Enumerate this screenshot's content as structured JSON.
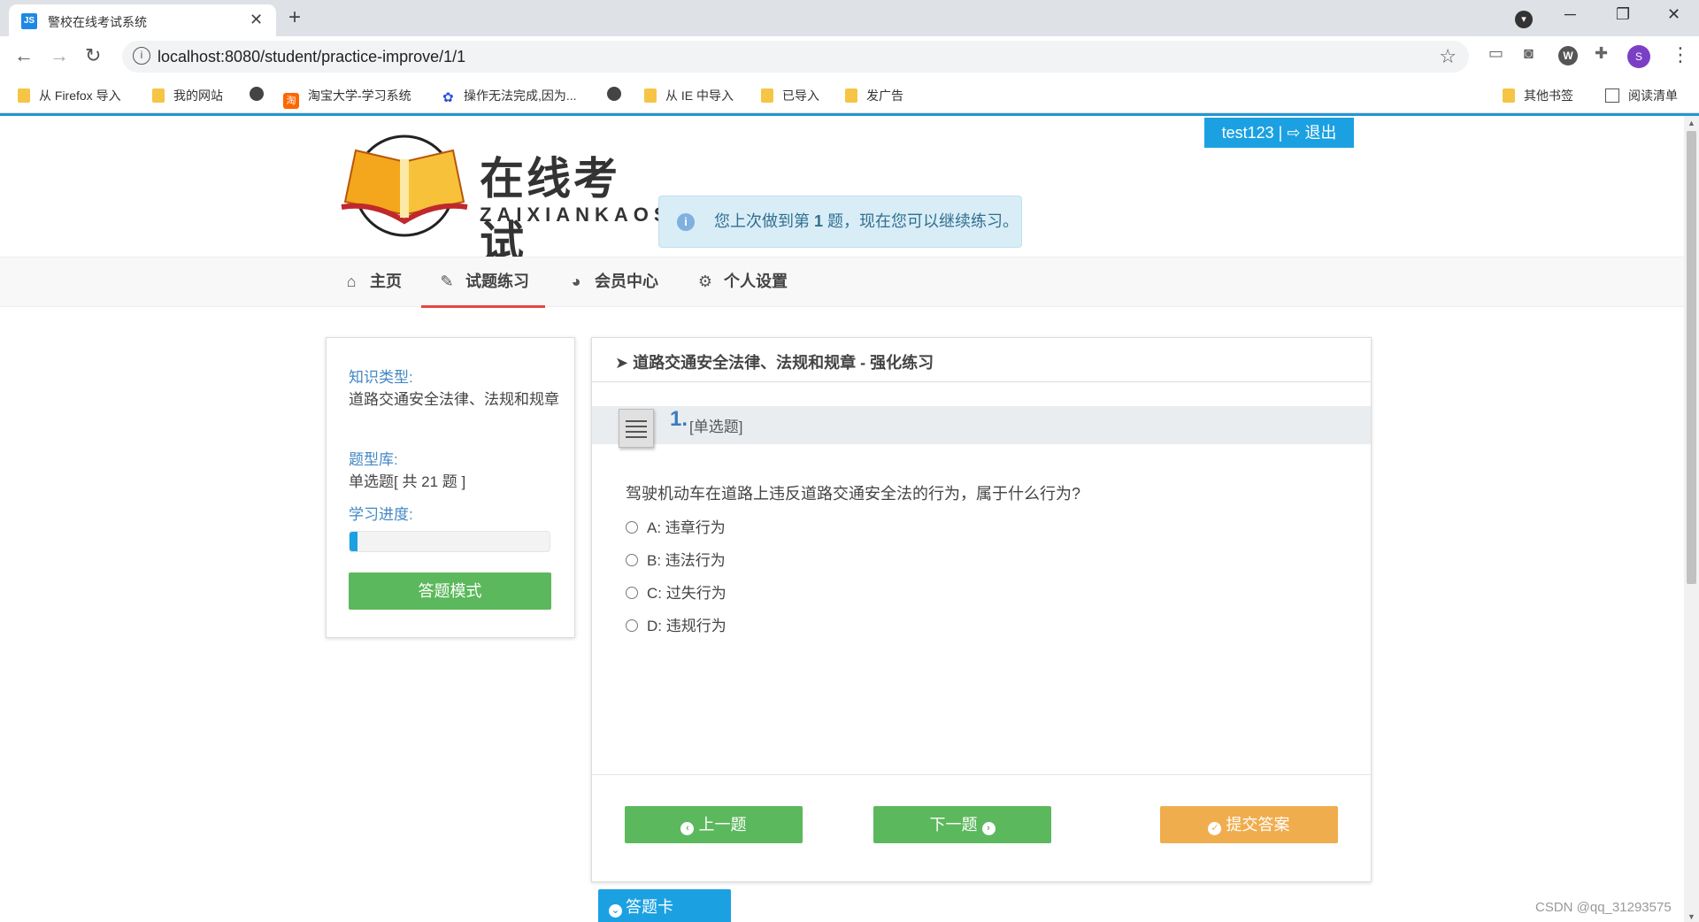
{
  "browser": {
    "tab_title": "警校在线考试系统",
    "tab_favicon": "JS",
    "url": "localhost:8080/student/practice-improve/1/1",
    "profile_initial": "S",
    "ext_w": "W"
  },
  "bookmarks": [
    "从 Firefox 导入",
    "我的网站",
    "淘宝大学-学习系统",
    "操作无法完成,因为...",
    "从 IE 中导入",
    "已导入",
    "发广告",
    "其他书签",
    "阅读清单"
  ],
  "userbar": {
    "username": "test123",
    "separator": "|",
    "logout": "退出"
  },
  "logo": {
    "title_cn": "在线考试",
    "title_en": "ZAIXIANKAOSHI"
  },
  "notice": {
    "before": "您上次做到第 ",
    "num": "1",
    "after": " 题，现在您可以继续练习。"
  },
  "nav": [
    {
      "label": "主页",
      "icon": "home-icon"
    },
    {
      "label": "试题练习",
      "icon": "edit-icon"
    },
    {
      "label": "会员中心",
      "icon": "dashboard-icon"
    },
    {
      "label": "个人设置",
      "icon": "gears-icon"
    }
  ],
  "side": {
    "knowledge_label": "知识类型:",
    "knowledge_value": "道路交通安全法律、法规和规章",
    "bank_label": "题型库:",
    "bank_value": "单选题[ 共 21 题 ]",
    "progress_label": "学习进度:",
    "progress_fraction": 0.04,
    "mode_button": "答题模式"
  },
  "question": {
    "header": "道路交通安全法律、法规和规章 - 强化练习",
    "number": "1.",
    "type": "[单选题]",
    "stem": "驾驶机动车在道路上违反道路交通安全法的行为，属于什么行为?",
    "options": [
      "A: 违章行为",
      "B: 违法行为",
      "C: 过失行为",
      "D: 违规行为"
    ],
    "prev": "上一题",
    "next": "下一题",
    "submit": "提交答案"
  },
  "answer_card": "答题卡",
  "watermark": "CSDN @qq_31293575"
}
